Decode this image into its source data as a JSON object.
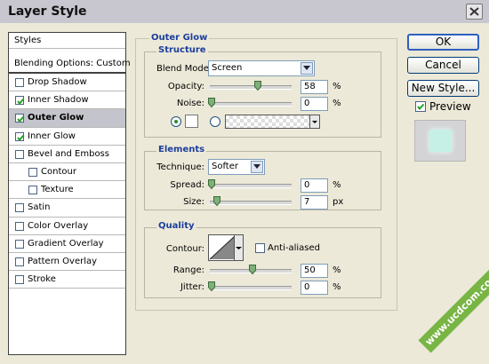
{
  "window": {
    "title": "Layer Style",
    "close_icon": "close-icon"
  },
  "styles_list": {
    "header": "Styles",
    "blending": "Blending Options: Custom",
    "items": [
      {
        "label": "Drop Shadow",
        "checked": false,
        "indent": false,
        "selected": false
      },
      {
        "label": "Inner Shadow",
        "checked": true,
        "indent": false,
        "selected": false
      },
      {
        "label": "Outer Glow",
        "checked": true,
        "indent": false,
        "selected": true
      },
      {
        "label": "Inner Glow",
        "checked": true,
        "indent": false,
        "selected": false
      },
      {
        "label": "Bevel and Emboss",
        "checked": false,
        "indent": false,
        "selected": false
      },
      {
        "label": "Contour",
        "checked": false,
        "indent": true,
        "selected": false
      },
      {
        "label": "Texture",
        "checked": false,
        "indent": true,
        "selected": false
      },
      {
        "label": "Satin",
        "checked": false,
        "indent": false,
        "selected": false
      },
      {
        "label": "Color Overlay",
        "checked": false,
        "indent": false,
        "selected": false
      },
      {
        "label": "Gradient Overlay",
        "checked": false,
        "indent": false,
        "selected": false
      },
      {
        "label": "Pattern Overlay",
        "checked": false,
        "indent": false,
        "selected": false
      },
      {
        "label": "Stroke",
        "checked": false,
        "indent": false,
        "selected": false
      }
    ]
  },
  "outer_glow": {
    "title": "Outer Glow",
    "structure": {
      "title": "Structure",
      "blend_mode_label": "Blend Mode:",
      "blend_mode_value": "Screen",
      "opacity_label": "Opacity:",
      "opacity_value": "58",
      "opacity_unit": "%",
      "opacity_level": 0.58,
      "noise_label": "Noise:",
      "noise_value": "0",
      "noise_unit": "%",
      "noise_level": 0,
      "color_mode_selected": "solid",
      "glow_color": "#ffffff"
    },
    "elements": {
      "title": "Elements",
      "technique_label": "Technique:",
      "technique_value": "Softer",
      "spread_label": "Spread:",
      "spread_value": "0",
      "spread_unit": "%",
      "spread_level": 0,
      "size_label": "Size:",
      "size_value": "7",
      "size_unit": "px",
      "size_level": 0.03
    },
    "quality": {
      "title": "Quality",
      "contour_label": "Contour:",
      "anti_aliased_label": "Anti-aliased",
      "anti_aliased_checked": false,
      "range_label": "Range:",
      "range_value": "50",
      "range_unit": "%",
      "range_level": 0.5,
      "jitter_label": "Jitter:",
      "jitter_value": "0",
      "jitter_unit": "%",
      "jitter_level": 0
    }
  },
  "buttons": {
    "ok": "OK",
    "cancel": "Cancel",
    "new_style": "New Style..."
  },
  "preview": {
    "label": "Preview",
    "checked": true,
    "swatch_color": "#c6f0e6"
  },
  "watermark": "www.ucdcom.com",
  "colors": {
    "accent": "#1c3e9c",
    "dialog_bg": "#ece9d8",
    "selected_row": "#c4c4cc"
  }
}
